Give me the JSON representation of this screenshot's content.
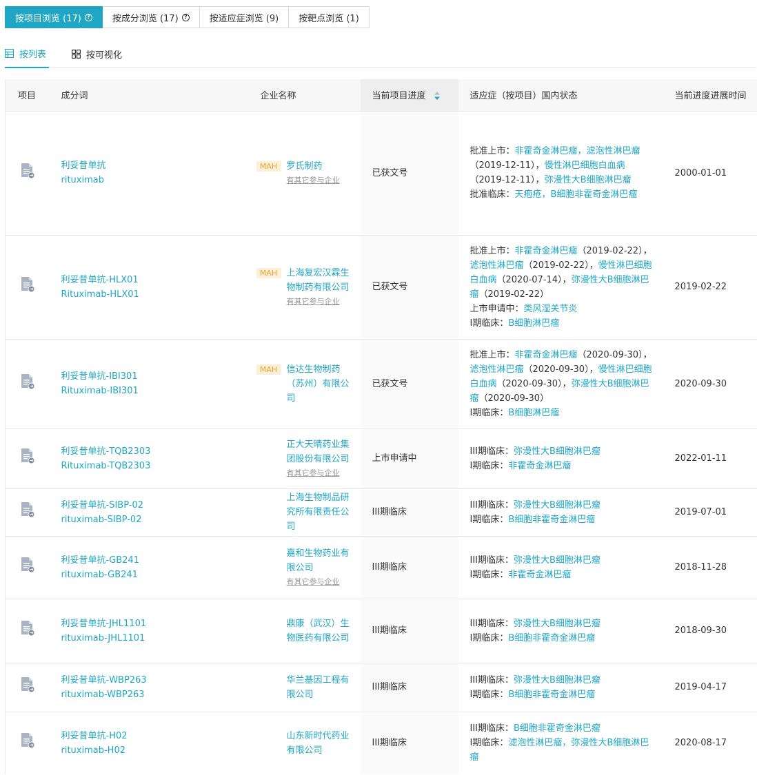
{
  "top_tabs": [
    {
      "label": "按项目浏览 (17)",
      "has_help": true,
      "active": true
    },
    {
      "label": "按成分浏览 (17)",
      "has_help": true,
      "active": false
    },
    {
      "label": "按适应症浏览 (9)",
      "has_help": false,
      "active": false
    },
    {
      "label": "按靶点浏览 (1)",
      "has_help": false,
      "active": false
    }
  ],
  "help_glyph": "?",
  "view_tabs": [
    {
      "label": "按列表",
      "icon": "table-icon",
      "active": true
    },
    {
      "label": "按可视化",
      "icon": "grid-icon",
      "active": false
    }
  ],
  "table": {
    "headers": [
      "项目",
      "成分词",
      "企业名称",
      "当前项目进度",
      "适应症（按项目）国内状态",
      "当前进度进展时间"
    ],
    "mah_label": "MAH",
    "rows": [
      {
        "name_cn": "利妥昔单抗",
        "name_en": "rituximab",
        "mah": true,
        "company": "罗氏制药",
        "other": "有其它参与企业",
        "progress": "已获文号",
        "indications": [
          [
            {
              "t": "批准上市：",
              "l": false
            },
            {
              "t": "非霍奇金淋巴瘤，滤泡性淋巴瘤",
              "l": true
            },
            {
              "t": "（2019-12-11），",
              "l": false
            },
            {
              "t": "慢性淋巴细胞白血病",
              "l": true
            },
            {
              "t": "（2019-12-11），",
              "l": false
            },
            {
              "t": "弥漫性大B细胞淋巴瘤",
              "l": true
            }
          ],
          [
            {
              "t": "批准临床：",
              "l": false
            },
            {
              "t": "天疱疮，B细胞非霍奇金淋巴瘤",
              "l": true
            }
          ]
        ],
        "date": "2000-01-01"
      },
      {
        "name_cn": "利妥昔单抗-HLX01",
        "name_en": "Rituximab-HLX01",
        "mah": true,
        "company": "上海复宏汉霖生物制药有限公司",
        "other": "有其它参与企业",
        "progress": "已获文号",
        "indications": [
          [
            {
              "t": "批准上市：",
              "l": false
            },
            {
              "t": "非霍奇金淋巴瘤",
              "l": true
            },
            {
              "t": "（2019-02-22），",
              "l": false
            },
            {
              "t": "滤泡性淋巴瘤",
              "l": true
            },
            {
              "t": "（2019-02-22），",
              "l": false
            },
            {
              "t": "慢性淋巴细胞白血病",
              "l": true
            },
            {
              "t": "（2020-07-14），",
              "l": false
            },
            {
              "t": "弥漫性大B细胞淋巴瘤",
              "l": true
            },
            {
              "t": "（2019-02-22）",
              "l": false
            }
          ],
          [
            {
              "t": "上市申请中：",
              "l": false
            },
            {
              "t": "类风湿关节炎",
              "l": true
            }
          ],
          [
            {
              "t": "I期临床：",
              "l": false
            },
            {
              "t": "B细胞淋巴瘤",
              "l": true
            }
          ]
        ],
        "date": "2019-02-22"
      },
      {
        "name_cn": "利妥昔单抗-IBI301",
        "name_en": "Rituximab-IBI301",
        "mah": true,
        "company": "信达生物制药（苏州）有限公司",
        "other": "",
        "progress": "已获文号",
        "indications": [
          [
            {
              "t": "批准上市：",
              "l": false
            },
            {
              "t": "非霍奇金淋巴瘤",
              "l": true
            },
            {
              "t": "（2020-09-30），",
              "l": false
            },
            {
              "t": "滤泡性淋巴瘤",
              "l": true
            },
            {
              "t": "（2020-09-30），",
              "l": false
            },
            {
              "t": "慢性淋巴细胞白血病",
              "l": true
            },
            {
              "t": "（2020-09-30），",
              "l": false
            },
            {
              "t": "弥漫性大B细胞淋巴瘤",
              "l": true
            },
            {
              "t": "（2020-09-30）",
              "l": false
            }
          ],
          [
            {
              "t": "I期临床：",
              "l": false
            },
            {
              "t": "B细胞淋巴瘤",
              "l": true
            }
          ]
        ],
        "date": "2020-09-30"
      },
      {
        "name_cn": "利妥昔单抗-TQB2303",
        "name_en": "Rituximab-TQB2303",
        "mah": false,
        "company": "正大天晴药业集团股份有限公司",
        "other": "有其它参与企业",
        "progress": "上市申请中",
        "indications": [
          [
            {
              "t": "III期临床：",
              "l": false
            },
            {
              "t": "弥漫性大B细胞淋巴瘤",
              "l": true
            }
          ],
          [
            {
              "t": "I期临床：",
              "l": false
            },
            {
              "t": "非霍奇金淋巴瘤",
              "l": true
            }
          ]
        ],
        "date": "2022-01-11"
      },
      {
        "name_cn": "利妥昔单抗-SIBP-02",
        "name_en": "rituximab-SIBP-02",
        "mah": false,
        "company": "上海生物制品研究所有限责任公司",
        "other": "",
        "progress": "III期临床",
        "indications": [
          [
            {
              "t": "III期临床：",
              "l": false
            },
            {
              "t": "弥漫性大B细胞淋巴瘤",
              "l": true
            }
          ],
          [
            {
              "t": "I期临床：",
              "l": false
            },
            {
              "t": "B细胞非霍奇金淋巴瘤",
              "l": true
            }
          ]
        ],
        "date": "2019-07-01"
      },
      {
        "name_cn": "利妥昔单抗-GB241",
        "name_en": "rituximab-GB241",
        "mah": false,
        "company": "嘉和生物药业有限公司",
        "other": "有其它参与企业",
        "progress": "III期临床",
        "indications": [
          [
            {
              "t": "III期临床：",
              "l": false
            },
            {
              "t": "弥漫性大B细胞淋巴瘤",
              "l": true
            }
          ],
          [
            {
              "t": "I期临床：",
              "l": false
            },
            {
              "t": "非霍奇金淋巴瘤",
              "l": true
            }
          ]
        ],
        "date": "2018-11-28"
      },
      {
        "name_cn": "利妥昔单抗-JHL1101",
        "name_en": "rituximab-JHL1101",
        "mah": false,
        "company": "鼎康（武汉）生物医药有限公司",
        "other": "",
        "progress": "III期临床",
        "indications": [
          [
            {
              "t": "III期临床：",
              "l": false
            },
            {
              "t": "弥漫性大B细胞淋巴瘤",
              "l": true
            }
          ],
          [
            {
              "t": "I期临床：",
              "l": false
            },
            {
              "t": "B细胞非霍奇金淋巴瘤",
              "l": true
            }
          ]
        ],
        "date": "2018-09-30"
      },
      {
        "name_cn": "利妥昔单抗-WBP263",
        "name_en": "rituximab-WBP263",
        "mah": false,
        "company": "华兰基因工程有限公司",
        "other": "",
        "progress": "III期临床",
        "indications": [
          [
            {
              "t": "III期临床：",
              "l": false
            },
            {
              "t": "弥漫性大B细胞淋巴瘤",
              "l": true
            }
          ],
          [
            {
              "t": "I期临床：",
              "l": false
            },
            {
              "t": "B细胞非霍奇金淋巴瘤",
              "l": true
            }
          ]
        ],
        "date": "2019-04-17"
      },
      {
        "name_cn": "利妥昔单抗-H02",
        "name_en": "rituximab-H02",
        "mah": false,
        "company": "山东新时代药业有限公司",
        "other": "",
        "progress": "III期临床",
        "indications": [
          [
            {
              "t": "III期临床：",
              "l": false
            },
            {
              "t": "B细胞非霍奇金淋巴瘤",
              "l": true
            }
          ],
          [
            {
              "t": "I期临床：",
              "l": false
            },
            {
              "t": "滤泡性淋巴瘤，弥漫性大B细胞淋巴瘤",
              "l": true
            }
          ]
        ],
        "date": "2020-08-17"
      }
    ]
  },
  "colors": {
    "accent": "#1fa6c4",
    "mah_bg": "#fdf0d8",
    "mah_text": "#e8a33a",
    "muted": "#999999"
  }
}
